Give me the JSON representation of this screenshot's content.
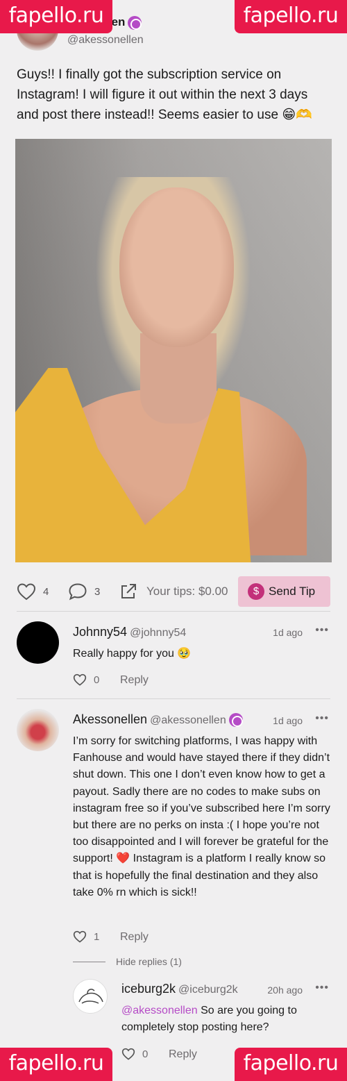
{
  "watermark": "fapello.ru",
  "post": {
    "author_name": "Akessonellen",
    "author_name_visible": "ssonellen",
    "author_handle": "@akessonellen",
    "text": "Guys!! I finally got the subscription service on Instagram! I will figure it out within the next 3 days and post there instead!! Seems easier to use 😁🫶",
    "likes": "4",
    "comments": "3",
    "tips_label": "Your tips: $0.00",
    "send_tip_label": "Send Tip",
    "dollar_symbol": "$"
  },
  "comments": [
    {
      "name": "Johnny54",
      "handle": "@johnny54",
      "time": "1d ago",
      "body": "Really happy for you 🥹",
      "likes": "0",
      "reply_label": "Reply"
    },
    {
      "name": "Akessonellen",
      "handle": "@akessonellen",
      "time": "1d ago",
      "body": "I’m sorry for switching platforms, I was happy with Fanhouse and would have stayed there if they didn’t shut down. This one I don’t even know how to get a payout. Sadly there are no codes to make subs on instagram free so if you’ve subscribed here I’m sorry but there are no perks on insta :( I hope you’re not too disappointed and I will forever be grateful for the support! ❤️ Instagram is a platform I really know so that is hopefully the final destination and they also take 0% rn which is sick!!",
      "likes": "1",
      "reply_label": "Reply"
    }
  ],
  "hide_replies_label": "Hide replies (1)",
  "reply": {
    "name": "iceburg2k",
    "handle": "@iceburg2k",
    "time": "20h ago",
    "mention": "@akessonellen",
    "body": " So are you going to completely stop posting here?",
    "likes": "0",
    "reply_label": "Reply"
  },
  "more_glyph": "•••",
  "colors": {
    "watermark": "#e8194a",
    "verified": "#b54bc6",
    "tip_button": "#eec2d3",
    "dollar": "#c3307a"
  }
}
